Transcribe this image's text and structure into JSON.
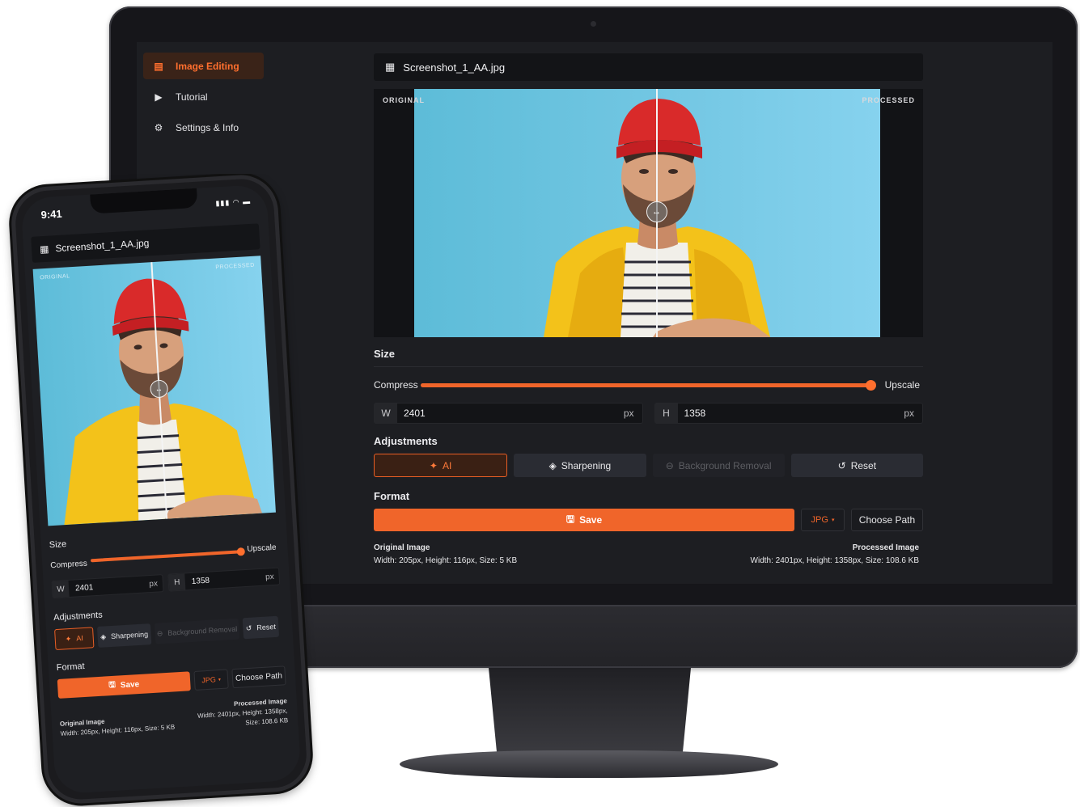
{
  "sidebar": {
    "items": [
      {
        "label": "Image Editing",
        "icon": "image-editing-icon",
        "active": true
      },
      {
        "label": "Tutorial",
        "icon": "play-icon",
        "active": false
      },
      {
        "label": "Settings & Info",
        "icon": "gear-icon",
        "active": false
      }
    ]
  },
  "file": {
    "name": "Screenshot_1_AA.jpg",
    "icon": "image-file-icon"
  },
  "preview": {
    "original_label": "ORIGINAL",
    "processed_label": "PROCESSED",
    "split_position": 0.52
  },
  "size": {
    "title": "Size",
    "compress_label": "Compress",
    "upscale_label": "Upscale",
    "slider_value": 1.0,
    "width_tag": "W",
    "width_value": "2401",
    "height_tag": "H",
    "height_value": "1358",
    "unit": "px"
  },
  "adjustments": {
    "title": "Adjustments",
    "ai_label": "AI",
    "sharpening_label": "Sharpening",
    "background_removal_label": "Background Removal",
    "reset_label": "Reset"
  },
  "format": {
    "title": "Format",
    "save_label": "Save",
    "format_value": "JPG",
    "choose_path_label": "Choose Path"
  },
  "info": {
    "original_title": "Original Image",
    "original_details": "Width: 205px, Height: 116px, Size: 5 KB",
    "processed_title": "Processed Image",
    "processed_details": "Width: 2401px, Height: 1358px, Size: 108.6 KB",
    "processed_details_line1": "Width: 2401px, Height: 1358px,",
    "processed_details_line2": "Size: 108.6 KB"
  },
  "phone": {
    "time": "9:41"
  },
  "colors": {
    "accent": "#f0652a",
    "background": "#1d1e22",
    "panel": "#131417"
  }
}
